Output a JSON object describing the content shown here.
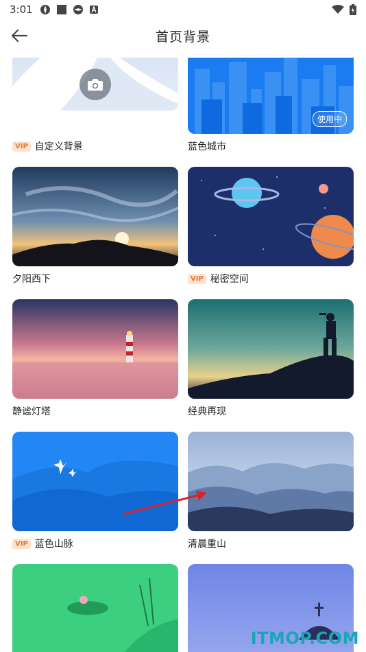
{
  "status_bar": {
    "time": "3:01"
  },
  "header": {
    "title": "首页背景"
  },
  "items": [
    {
      "label": "自定义背景",
      "vip": "VIP"
    },
    {
      "label": "蓝色城市",
      "badge": "使用中"
    },
    {
      "label": "夕阳西下"
    },
    {
      "label": "秘密空间",
      "vip": "VIP"
    },
    {
      "label": "静谧灯塔"
    },
    {
      "label": "经典再现"
    },
    {
      "label": "蓝色山脉",
      "vip": "VIP"
    },
    {
      "label": "清晨重山"
    },
    {
      "label": ""
    },
    {
      "label": ""
    }
  ],
  "watermark": "ITMOP.COM",
  "colors": {
    "accent": "#1a7cf0",
    "vip_bg": "#fde3cf",
    "vip_text": "#e0762f"
  }
}
